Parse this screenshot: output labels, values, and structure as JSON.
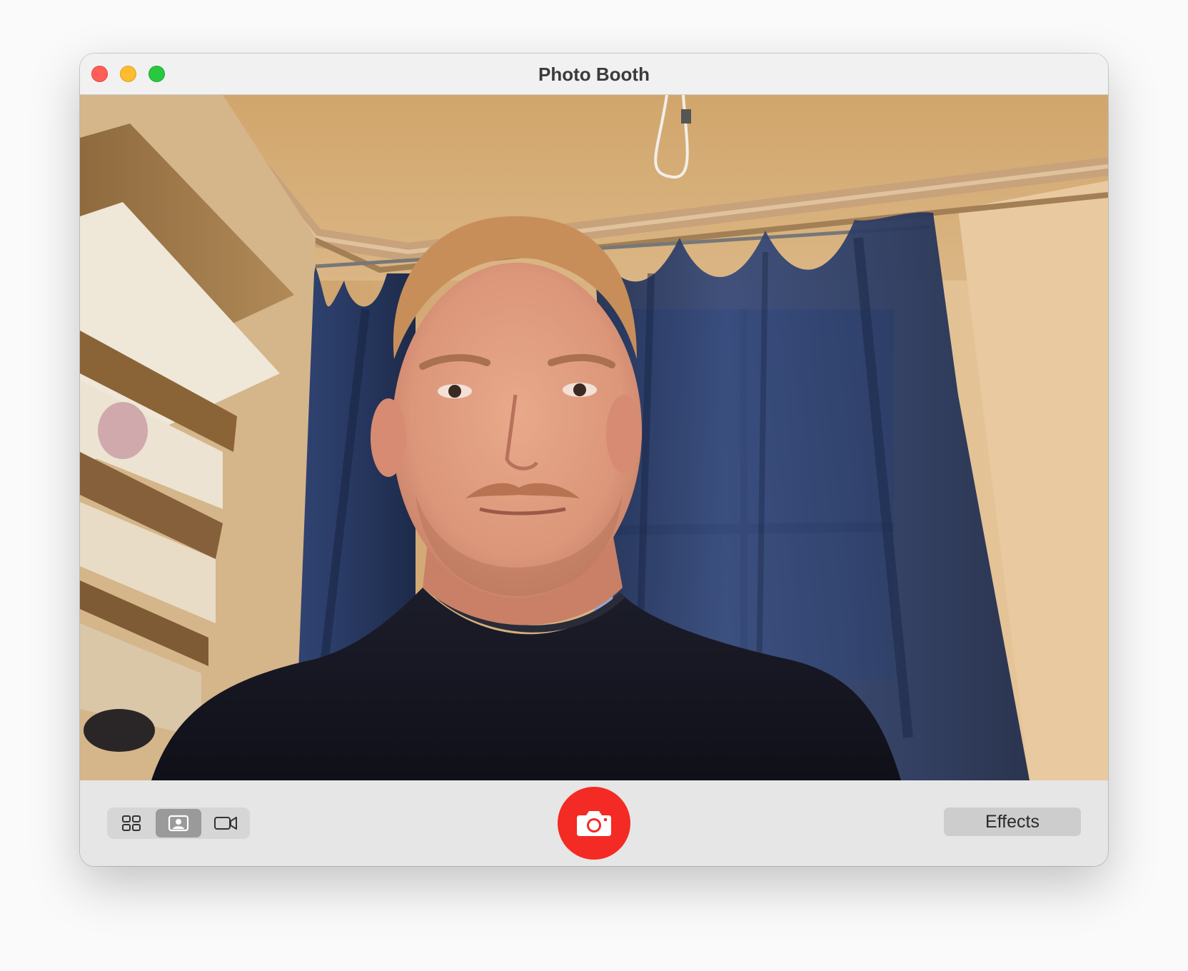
{
  "window": {
    "title": "Photo Booth"
  },
  "titlebar": {
    "close_icon": "close-traffic-light",
    "minimize_icon": "minimize-traffic-light",
    "zoom_icon": "zoom-traffic-light"
  },
  "preview": {
    "content": "live-camera-feed"
  },
  "toolbar": {
    "view_modes": [
      {
        "name": "grid-view-icon",
        "selected": false
      },
      {
        "name": "single-photo-icon",
        "selected": true
      },
      {
        "name": "video-icon",
        "selected": false
      }
    ],
    "shutter_icon": "camera-icon",
    "effects_label": "Effects"
  },
  "colors": {
    "shutter": "#f42a24",
    "selected_segment": "#9a9a9a",
    "close": "#ff5f57",
    "minimize": "#febc2e",
    "zoom": "#28c840"
  }
}
